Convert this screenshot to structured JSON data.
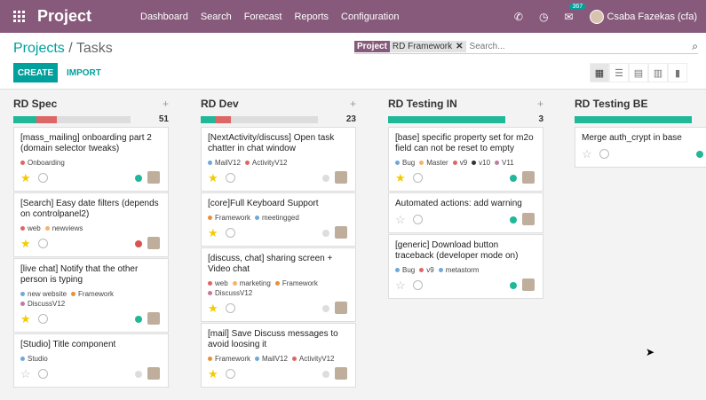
{
  "app": {
    "title": "Project",
    "menu": [
      "Dashboard",
      "Search",
      "Forecast",
      "Reports",
      "Configuration"
    ],
    "user": "Csaba Fazekas (cfa)",
    "chat_badge": "367",
    "color": "#875a7b"
  },
  "breadcrumb": {
    "parent": "Projects",
    "separator": "/",
    "current": "Tasks"
  },
  "search": {
    "facet_label": "Project",
    "facet_value": "RD Framework",
    "placeholder": "Search..."
  },
  "buttons": {
    "create": "CREATE",
    "import": "IMPORT"
  },
  "views": [
    "kanban",
    "list",
    "calendar",
    "pivot",
    "graph"
  ],
  "columns": [
    {
      "title": "RD Spec",
      "count": "51",
      "progress": {
        "green": 0.2,
        "red": 0.17
      },
      "cards": [
        {
          "title": "[mass_mailing] onboarding part 2 (domain selector tweaks)",
          "tags": [
            {
              "name": "Onboarding",
              "color": "#e06666"
            }
          ],
          "starred": true,
          "status": "green"
        },
        {
          "title": "[Search] Easy date filters (depends on controlpanel2)",
          "tags": [
            {
              "name": "web",
              "color": "#e06666"
            },
            {
              "name": "newviews",
              "color": "#f6b26b"
            }
          ],
          "starred": true,
          "status": "red"
        },
        {
          "title": "[live chat] Notify that the other person is typing",
          "tags": [
            {
              "name": "new website",
              "color": "#6fa8dc"
            },
            {
              "name": "Framework",
              "color": "#e69138"
            },
            {
              "name": "DiscussV12",
              "color": "#c27ba0"
            }
          ],
          "starred": true,
          "status": "green"
        },
        {
          "title": "[Studio] Title component",
          "tags": [
            {
              "name": "Studio",
              "color": "#6fa8dc"
            }
          ],
          "starred": false,
          "status": "grey"
        }
      ]
    },
    {
      "title": "RD Dev",
      "count": "23",
      "progress": {
        "green": 0.12,
        "red": 0.14
      },
      "cards": [
        {
          "title": "[NextActivity/discuss] Open task chatter in chat window",
          "tags": [
            {
              "name": "MailV12",
              "color": "#6fa8dc"
            },
            {
              "name": "ActivityV12",
              "color": "#e06666"
            }
          ],
          "starred": true,
          "status": "grey"
        },
        {
          "title": "[core]Full Keyboard Support",
          "tags": [
            {
              "name": "Framework",
              "color": "#e69138"
            },
            {
              "name": "meetingged",
              "color": "#6fa8dc"
            }
          ],
          "starred": true,
          "status": "grey"
        },
        {
          "title": "[discuss, chat] sharing screen + Video chat",
          "tags": [
            {
              "name": "web",
              "color": "#e06666"
            },
            {
              "name": "marketing",
              "color": "#f6b26b"
            },
            {
              "name": "Framework",
              "color": "#e69138"
            },
            {
              "name": "DiscussV12",
              "color": "#c27ba0"
            }
          ],
          "starred": true,
          "status": "grey"
        },
        {
          "title": "[mail] Save Discuss messages to avoid loosing it",
          "tags": [
            {
              "name": "Framework",
              "color": "#e69138"
            },
            {
              "name": "MailV12",
              "color": "#6fa8dc"
            },
            {
              "name": "ActivityV12",
              "color": "#e06666"
            }
          ],
          "starred": true,
          "status": "grey"
        }
      ]
    },
    {
      "title": "RD Testing IN",
      "count": "3",
      "progress": {
        "green": 1.0,
        "red": 0
      },
      "cards": [
        {
          "title": "[base] specific property set for m2o field can not be reset to empty",
          "tags": [
            {
              "name": "Bug",
              "color": "#6fa8dc"
            },
            {
              "name": "Master",
              "color": "#f6b26b"
            },
            {
              "name": "v9",
              "color": "#e06666"
            },
            {
              "name": "v10",
              "color": "#333333"
            },
            {
              "name": "V11",
              "color": "#c27ba0"
            }
          ],
          "starred": true,
          "status": "green"
        },
        {
          "title": "Automated actions: add warning",
          "tags": [],
          "starred": false,
          "status": "green"
        },
        {
          "title": "[generic] Download button traceback (developer mode on)",
          "tags": [
            {
              "name": "Bug",
              "color": "#6fa8dc"
            },
            {
              "name": "v9",
              "color": "#e06666"
            },
            {
              "name": "metastorm",
              "color": "#6fa8dc"
            }
          ],
          "starred": false,
          "status": "green"
        }
      ]
    },
    {
      "title": "RD Testing BE",
      "count": "",
      "progress": {
        "green": 1.0,
        "red": 0
      },
      "cards": [
        {
          "title": "Merge auth_crypt in base",
          "tags": [],
          "starred": false,
          "status": "green"
        }
      ]
    }
  ]
}
